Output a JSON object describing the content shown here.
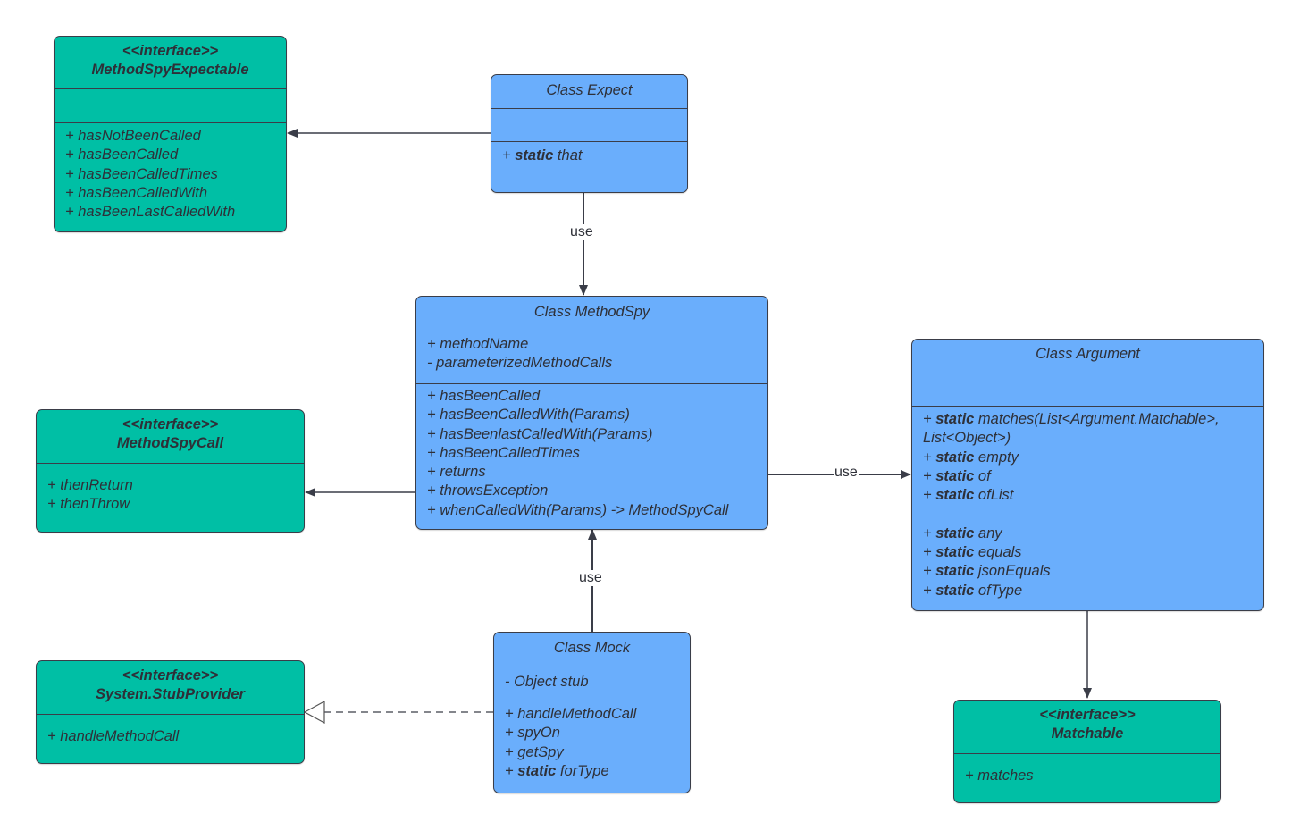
{
  "diagram": {
    "type": "uml-class-diagram",
    "colors": {
      "interface_fill": "#00bfa5",
      "class_fill": "#6aaefc",
      "stroke": "#3a3d48",
      "text": "#2e3038"
    },
    "boxes": {
      "method_spy_expectable": {
        "kind": "interface",
        "stereotype": "<<interface>>",
        "name": "MethodSpyExpectable",
        "attributes": [],
        "methods": [
          "+ hasNotBeenCalled",
          "+ hasBeenCalled",
          "+ hasBeenCalledTimes",
          "+ hasBeenCalledWith",
          "+ hasBeenLastCalledWith"
        ]
      },
      "expect": {
        "kind": "class",
        "name": "Class Expect",
        "attributes": [],
        "methods": [
          {
            "prefix": "+ ",
            "keyword": "static",
            "name": " that"
          }
        ]
      },
      "method_spy": {
        "kind": "class",
        "name": "Class MethodSpy",
        "attributes": [
          "+ methodName",
          "- parameterizedMethodCalls"
        ],
        "methods": [
          "+ hasBeenCalled",
          "+ hasBeenCalledWith(Params)",
          "+ hasBeenlastCalledWith(Params)",
          "+ hasBeenCalledTimes",
          "+ returns",
          "+ throwsException",
          "+ whenCalledWith(Params) -> MethodSpyCall"
        ]
      },
      "method_spy_call": {
        "kind": "interface",
        "stereotype": "<<interface>>",
        "name": "MethodSpyCall",
        "methods": [
          "+ thenReturn",
          "+ thenThrow"
        ]
      },
      "argument": {
        "kind": "class",
        "name": "Class Argument",
        "attributes": [],
        "methods": [
          {
            "prefix": "+ ",
            "keyword": "static",
            "name": " matches(List<Argument.Matchable>,"
          },
          {
            "prefix": "",
            "keyword": "",
            "name": "List<Object>)"
          },
          {
            "prefix": "+ ",
            "keyword": "static",
            "name": " empty"
          },
          {
            "prefix": "+ ",
            "keyword": "static",
            "name": " of"
          },
          {
            "prefix": "+ ",
            "keyword": "static",
            "name": " ofList"
          },
          {
            "prefix": "+ ",
            "keyword": "static",
            "name": " any"
          },
          {
            "prefix": "+ ",
            "keyword": "static",
            "name": " equals"
          },
          {
            "prefix": "+ ",
            "keyword": "static",
            "name": " jsonEquals"
          },
          {
            "prefix": "+ ",
            "keyword": "static",
            "name": " ofType"
          }
        ]
      },
      "stub_provider": {
        "kind": "interface",
        "stereotype": "<<interface>>",
        "name": "System.StubProvider",
        "methods": [
          "+ handleMethodCall"
        ]
      },
      "mock": {
        "kind": "class",
        "name": "Class Mock",
        "attributes": [
          "- Object stub"
        ],
        "methods": [
          {
            "prefix": "+ ",
            "keyword": "",
            "name": "handleMethodCall"
          },
          {
            "prefix": "+ ",
            "keyword": "",
            "name": "spyOn"
          },
          {
            "prefix": "+ ",
            "keyword": "",
            "name": "getSpy"
          },
          {
            "prefix": "+ ",
            "keyword": "static",
            "name": " forType"
          }
        ]
      },
      "matchable": {
        "kind": "interface",
        "stereotype": "<<interface>>",
        "name": "Matchable",
        "methods": [
          "+ matches"
        ]
      }
    },
    "edges": [
      {
        "from": "Class Expect",
        "to": "MethodSpyExpectable",
        "style": "solid",
        "arrow": "filled",
        "label": ""
      },
      {
        "from": "Class Expect",
        "to": "Class MethodSpy",
        "style": "solid",
        "arrow": "filled",
        "label": "use"
      },
      {
        "from": "Class MethodSpy",
        "to": "MethodSpyCall",
        "style": "solid",
        "arrow": "filled",
        "label": ""
      },
      {
        "from": "Class MethodSpy",
        "to": "Class Argument",
        "style": "solid",
        "arrow": "filled",
        "label": "use"
      },
      {
        "from": "Class Mock",
        "to": "Class MethodSpy",
        "style": "solid",
        "arrow": "filled",
        "label": "use"
      },
      {
        "from": "Class Mock",
        "to": "System.StubProvider",
        "style": "dashed",
        "arrow": "hollow-triangle",
        "label": ""
      },
      {
        "from": "Class Argument",
        "to": "Matchable",
        "style": "solid",
        "arrow": "filled",
        "label": ""
      }
    ]
  }
}
